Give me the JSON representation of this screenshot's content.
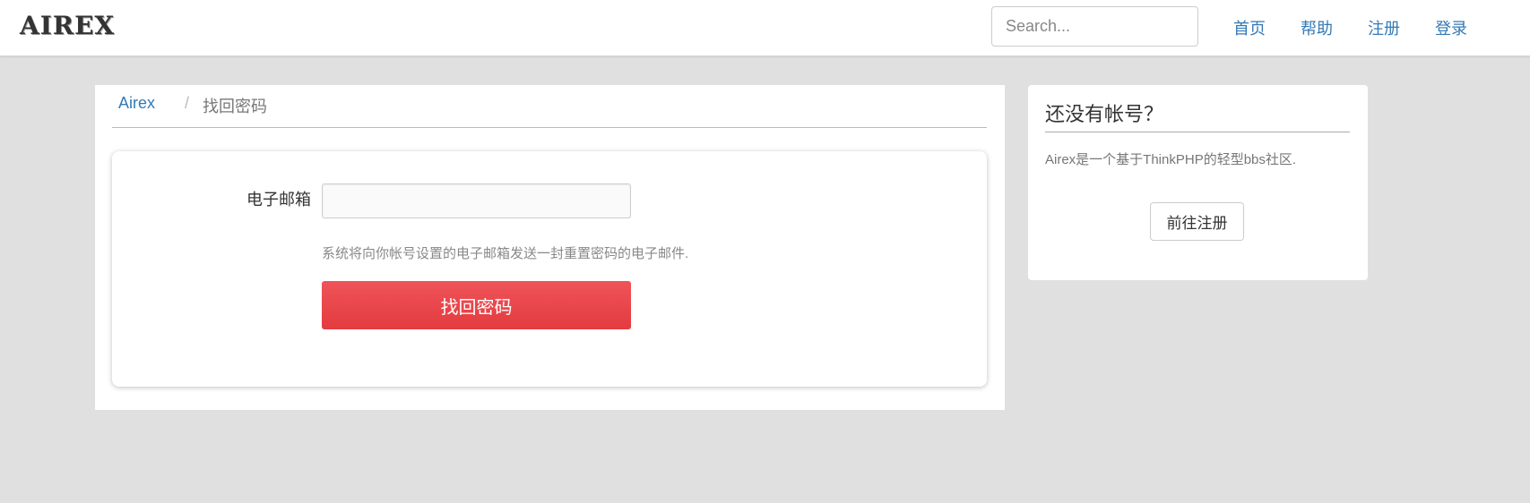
{
  "navbar": {
    "brand": "AIREX",
    "search_placeholder": "Search...",
    "links": [
      "首页",
      "帮助",
      "注册",
      "登录"
    ]
  },
  "breadcrumb": {
    "home": "Airex",
    "separator": "/",
    "current": "找回密码"
  },
  "form": {
    "email_label": "电子邮箱",
    "email_value": "",
    "help_text": "系统将向你帐号设置的电子邮箱发送一封重置密码的电子邮件.",
    "submit_label": "找回密码"
  },
  "sidebar": {
    "title": "还没有帐号？",
    "description": "Airex是一个基于ThinkPHP的轻型bbs社区.",
    "register_label": "前往注册"
  },
  "colors": {
    "link": "#337ab7",
    "primary_button": "#e84548",
    "background": "#e0e0e0"
  }
}
